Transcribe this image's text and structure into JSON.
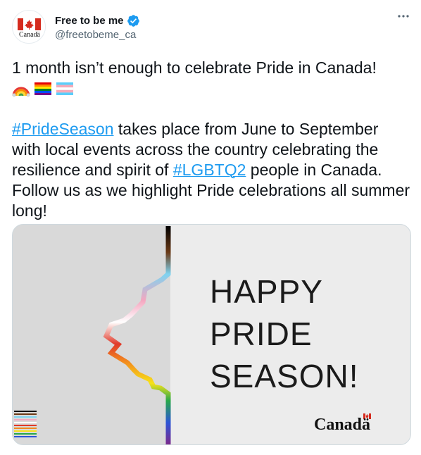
{
  "author": {
    "display_name": "Free to be me",
    "handle": "@freetobeme_ca",
    "avatar_wordmark": "Canadä",
    "verified": true
  },
  "tweet": {
    "line1": "1 month isn’t enough to celebrate Pride in Canada!",
    "emojis": [
      "rainbow-emoji",
      "rainbow-flag-emoji",
      "transgender-flag-emoji"
    ],
    "hashtag1": "#PrideSeason",
    "para2_a": " takes place from June to September with local events across the country celebrating the resilience and spirit of ",
    "hashtag2": "#LGBTQ2",
    "para2_b": " people in Canada. Follow us as we highlight Pride celebrations all summer long!"
  },
  "media": {
    "line1": "HAPPY",
    "line2": "PRIDE",
    "line3": "SEASON!",
    "wordmark": "Canadä"
  },
  "colors": {
    "hashtag": "#1d9bf0",
    "verified": "#1d9bf0",
    "flag_red": "#d52b1e"
  }
}
